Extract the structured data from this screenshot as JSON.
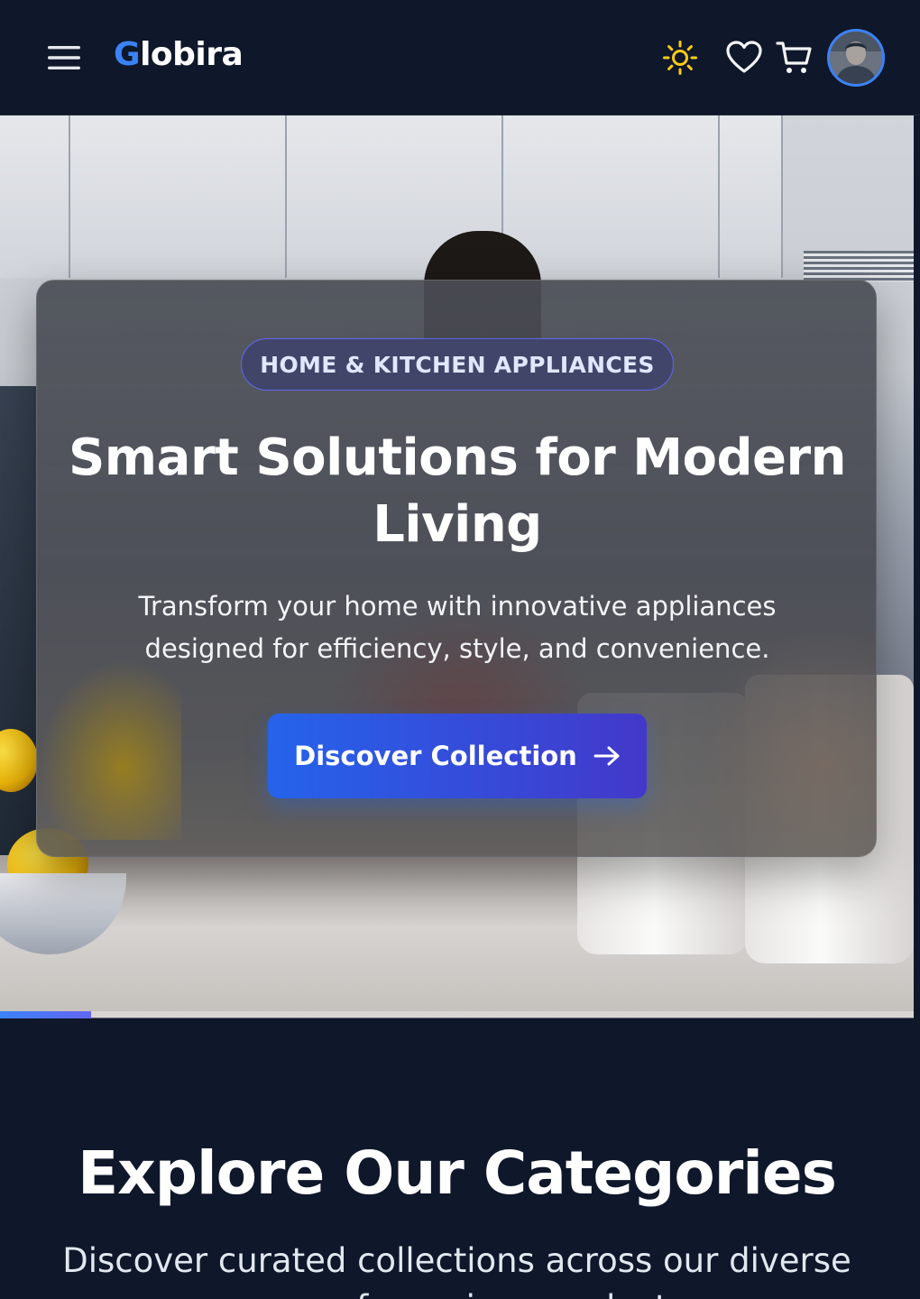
{
  "header": {
    "logo_initial": "G",
    "logo_rest": "lobira",
    "icons": [
      "menu-icon",
      "sun-icon",
      "heart-icon",
      "cart-icon"
    ]
  },
  "hero": {
    "badge": "HOME & KITCHEN APPLIANCES",
    "title": "Smart Solutions for Modern Living",
    "subtitle": "Transform your home with innovative appliances designed for efficiency, style, and convenience.",
    "cta_label": "Discover Collection",
    "slide_progress": 0.1
  },
  "categories": {
    "title": "Explore Our Categories",
    "subtitle": "Discover curated collections across our diverse range of premium products"
  },
  "colors": {
    "background": "#0f172a",
    "accent": "#3b82f6",
    "cta_start": "#2563eb",
    "cta_end": "#4338ca",
    "sun": "#facc15"
  }
}
